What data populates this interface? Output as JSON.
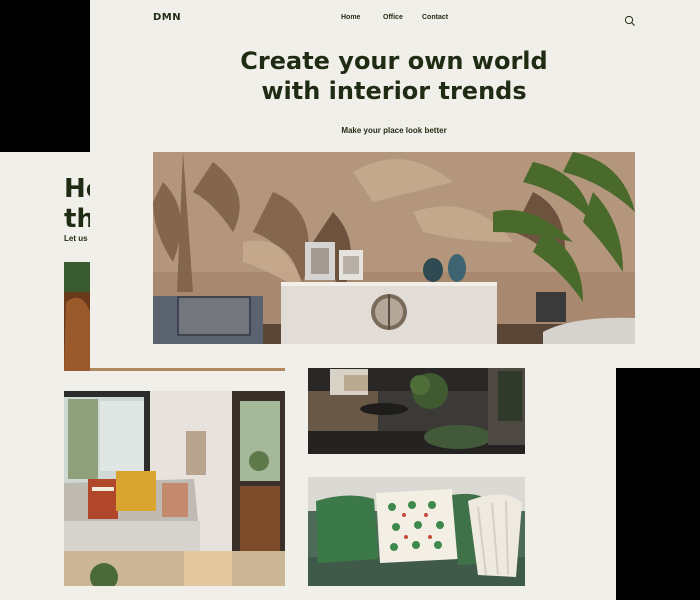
{
  "front_page": {
    "logo": "DMN",
    "nav": {
      "home": "Home",
      "office": "Office",
      "contact": "Contact"
    },
    "hero": {
      "title": "Create your own world\nwith interior trends",
      "subtitle": "Make your place look better"
    },
    "icons": {
      "search": "search-icon"
    }
  },
  "back_page": {
    "headline": "He\nth",
    "subtitle": "Let us"
  },
  "colors": {
    "page_background": "#f1efea",
    "text_dark_green": "#1f2b12",
    "backdrop": "#000000"
  }
}
